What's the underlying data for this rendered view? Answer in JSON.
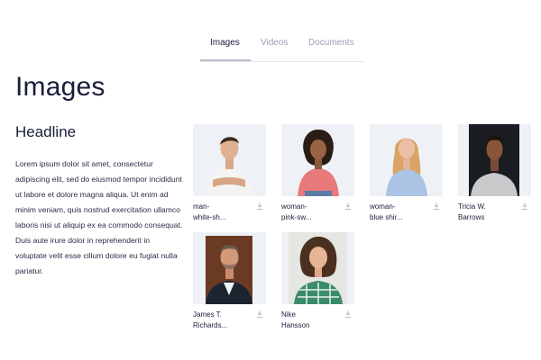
{
  "tabs": [
    {
      "label": "Images",
      "active": true
    },
    {
      "label": "Videos",
      "active": false
    },
    {
      "label": "Documents",
      "active": false
    }
  ],
  "page_title": "Images",
  "headline": "Headline",
  "body": "Lorem ipsum dolor sit amet, consectetur adipiscing elit, sed do eiusmod tempor incididunt ut labore et dolore magna aliqua. Ut enim ad minim veniam, quis nostrud exercitation ullamco laboris nisi ut aliquip ex ea commodo consequat. Duis aute irure dolor in reprehenderit in voluptate velit esse cillum dolore eu fugiat nulla pariatur.",
  "images": [
    {
      "caption_1": "man-",
      "caption_2": "white-sh...",
      "icon": "download-icon"
    },
    {
      "caption_1": "woman-",
      "caption_2": "pink-sw...",
      "icon": "download-icon"
    },
    {
      "caption_1": "woman-",
      "caption_2": "blue shir...",
      "icon": "download-icon"
    },
    {
      "caption_1": "Tricia W.",
      "caption_2": "Barrows",
      "icon": "download-icon"
    },
    {
      "caption_1": "James T.",
      "caption_2": "Richards...",
      "icon": "download-icon"
    },
    {
      "caption_1": "Nike",
      "caption_2": "Hansson",
      "icon": "download-icon"
    }
  ],
  "colors": {
    "accent": "#1a1d3a",
    "muted": "#9aa0b4",
    "thumb_bg": "#eef2f6"
  }
}
